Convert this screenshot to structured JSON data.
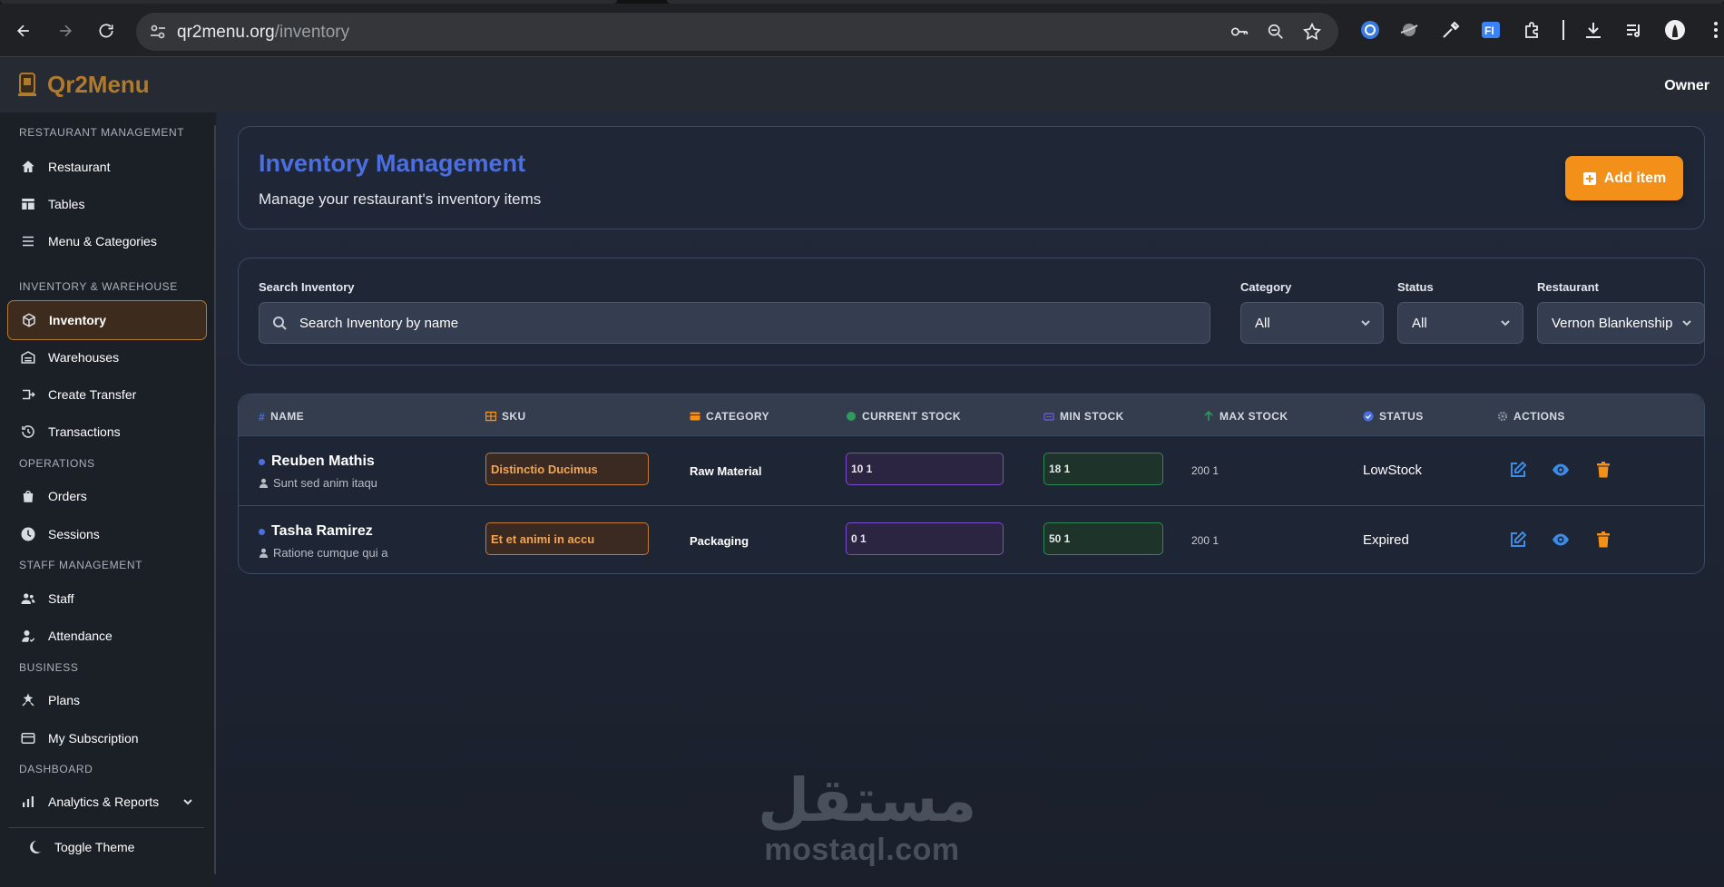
{
  "browser": {
    "url_host": "qr2menu.org",
    "url_path": "/inventory"
  },
  "app": {
    "brand": "Qr2Menu",
    "user_label": "Owner"
  },
  "sidebar": {
    "sections": [
      {
        "title": "RESTAURANT MANAGEMENT",
        "items": [
          {
            "label": "Restaurant",
            "icon": "home-icon"
          },
          {
            "label": "Tables",
            "icon": "tables-icon"
          },
          {
            "label": "Menu & Categories",
            "icon": "menu-list-icon"
          }
        ]
      },
      {
        "title": "INVENTORY & WAREHOUSE",
        "items": [
          {
            "label": "Inventory",
            "icon": "box-icon",
            "active": true
          },
          {
            "label": "Warehouses",
            "icon": "warehouse-icon"
          },
          {
            "label": "Create Transfer",
            "icon": "transfer-icon"
          },
          {
            "label": "Transactions",
            "icon": "history-icon"
          }
        ]
      },
      {
        "title": "OPERATIONS",
        "items": [
          {
            "label": "Orders",
            "icon": "bag-icon"
          },
          {
            "label": "Sessions",
            "icon": "clock-icon"
          }
        ]
      },
      {
        "title": "STAFF MANAGEMENT",
        "items": [
          {
            "label": "Staff",
            "icon": "users-icon"
          },
          {
            "label": "Attendance",
            "icon": "user-check-icon"
          }
        ]
      },
      {
        "title": "BUSINESS",
        "items": [
          {
            "label": "Plans",
            "icon": "plans-icon"
          },
          {
            "label": "My Subscription",
            "icon": "card-icon"
          }
        ]
      },
      {
        "title": "DASHBOARD",
        "items": [
          {
            "label": "Analytics & Reports",
            "icon": "chart-icon"
          }
        ]
      }
    ],
    "toggle_theme": "Toggle Theme"
  },
  "header_card": {
    "title": "Inventory Management",
    "subtitle": "Manage your restaurant's inventory items",
    "add_button": "Add item"
  },
  "filters": {
    "search_label": "Search Inventory",
    "search_placeholder": "Search Inventory by name",
    "category_label": "Category",
    "category_value": "All",
    "status_label": "Status",
    "status_value": "All",
    "restaurant_label": "Restaurant",
    "restaurant_value": "Vernon Blankenship"
  },
  "table": {
    "columns": [
      "NAME",
      "SKU",
      "CATEGORY",
      "CURRENT STOCK",
      "MIN STOCK",
      "MAX STOCK",
      "STATUS",
      "ACTIONS"
    ],
    "rows": [
      {
        "name": "Reuben Mathis",
        "desc": "Sunt sed anim itaqu",
        "sku": "Distinctio Ducimus",
        "category": "Raw Material",
        "current": "10 1",
        "min": "18 1",
        "max": "200 1",
        "status": "LowStock"
      },
      {
        "name": "Tasha Ramirez",
        "desc": "Ratione cumque qui a",
        "sku": "Et et animi in accu",
        "category": "Packaging",
        "current": "0 1",
        "min": "50 1",
        "max": "200 1",
        "status": "Expired"
      }
    ]
  },
  "watermark": {
    "arabic": "مستقل",
    "latin": "mostaql.com"
  },
  "colors": {
    "brand": "#b07a2d",
    "title_blue": "#4b6fe0",
    "accent_orange": "#f2901a",
    "edit_blue": "#3d8ce8",
    "delete_orange": "#f2901a"
  }
}
